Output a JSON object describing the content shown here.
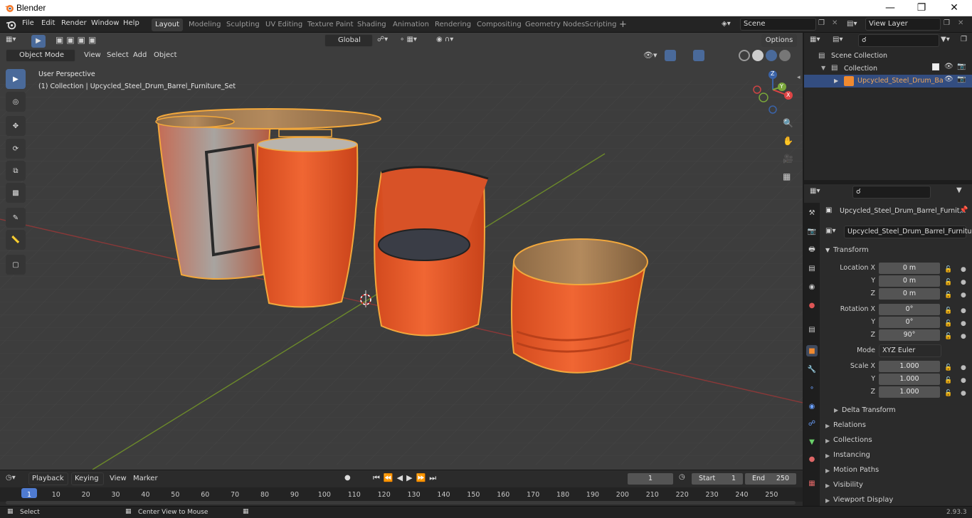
{
  "window": {
    "title": "Blender"
  },
  "menubar": {
    "items": [
      "File",
      "Edit",
      "Render",
      "Window",
      "Help"
    ]
  },
  "workspaces": [
    "Layout",
    "Modeling",
    "Sculpting",
    "UV Editing",
    "Texture Paint",
    "Shading",
    "Animation",
    "Rendering",
    "Compositing",
    "Geometry Nodes",
    "Scripting"
  ],
  "scene": {
    "name": "Scene",
    "view_layer": "View Layer"
  },
  "viewport": {
    "mode": "Object Mode",
    "menus": [
      "View",
      "Select",
      "Add",
      "Object"
    ],
    "transform_orientation": "Global",
    "options_label": "Options",
    "overlay_title": "User Perspective",
    "overlay_subtitle": "(1) Collection | Upcycled_Steel_Drum_Barrel_Furniture_Set",
    "gizmo": {
      "x": "X",
      "y": "Y",
      "z": "Z"
    }
  },
  "outliner": {
    "root": "Scene Collection",
    "collection": "Collection",
    "object": "Upcycled_Steel_Drum_Ba"
  },
  "properties": {
    "object_name": "Upcycled_Steel_Drum_Barrel_Furnit...",
    "data_name": "Upcycled_Steel_Drum_Barrel_Furniture_...",
    "transform_label": "Transform",
    "location_label": "Location X",
    "y_label": "Y",
    "z_label": "Z",
    "location": [
      "0 m",
      "0 m",
      "0 m"
    ],
    "rotation_label": "Rotation X",
    "rotation": [
      "0°",
      "0°",
      "90°"
    ],
    "mode_label": "Mode",
    "mode": "XYZ Euler",
    "scale_label": "Scale X",
    "scale": [
      "1.000",
      "1.000",
      "1.000"
    ],
    "delta": "Delta Transform",
    "sections": [
      "Relations",
      "Collections",
      "Instancing",
      "Motion Paths",
      "Visibility",
      "Viewport Display"
    ]
  },
  "timeline": {
    "menus": [
      "Playback",
      "Keying",
      "View",
      "Marker"
    ],
    "current_frame": "1",
    "start_label": "Start",
    "start": "1",
    "end_label": "End",
    "end": "250",
    "ticks": [
      "1",
      "10",
      "20",
      "30",
      "40",
      "50",
      "60",
      "70",
      "80",
      "90",
      "100",
      "110",
      "120",
      "130",
      "140",
      "150",
      "160",
      "170",
      "180",
      "190",
      "200",
      "210",
      "220",
      "230",
      "240",
      "250"
    ]
  },
  "statusbar": {
    "select": "Select",
    "center": "Center View to Mouse",
    "version": "2.93.3"
  }
}
